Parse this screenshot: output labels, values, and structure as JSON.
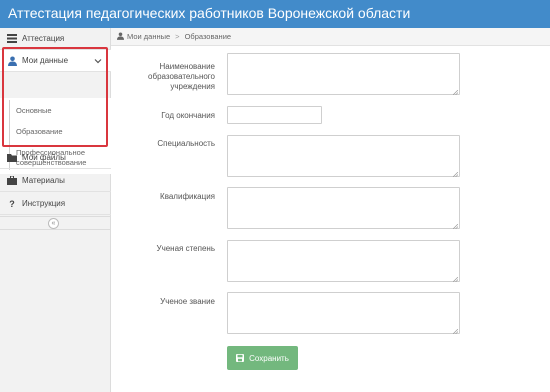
{
  "app": {
    "title": "Аттестация педагогических работников Воронежской области"
  },
  "sidebar": {
    "items": [
      {
        "label": "Аттестация",
        "icon": "server-icon"
      },
      {
        "label": "Мои данные",
        "icon": "user-icon"
      },
      {
        "label": "Мои файлы",
        "icon": "folder-icon"
      },
      {
        "label": "Материалы",
        "icon": "briefcase-icon"
      },
      {
        "label": "Инструкция",
        "icon": "question-icon"
      }
    ],
    "submenu": [
      {
        "label": "Основные"
      },
      {
        "label": "Образование"
      },
      {
        "label": "Профессиональное"
      },
      {
        "label": "совершенствование"
      }
    ],
    "collapse_label": "«"
  },
  "breadcrumb": {
    "items": [
      "Мои данные",
      "Образование"
    ],
    "separator": ">"
  },
  "form": {
    "institution_label_1": "Наименование",
    "institution_label_2": "образовательного",
    "institution_label_3": "учреждения",
    "year_label": "Год окончания",
    "specialty_label": "Специальность",
    "qualification_label": "Квалификация",
    "degree_label": "Ученая степень",
    "title_label": "Ученое звание",
    "save_label": "Сохранить"
  },
  "colors": {
    "topbar": "#428bca",
    "save_button": "#73b87e",
    "highlight": "#d9363e"
  }
}
